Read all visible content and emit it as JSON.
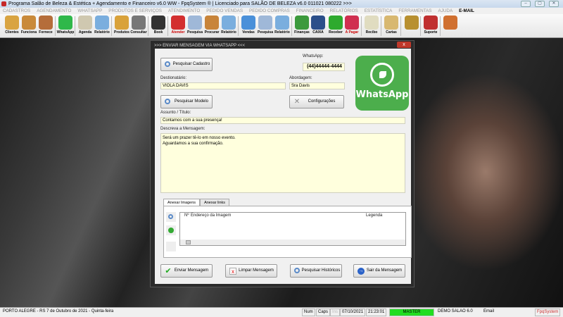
{
  "window": {
    "title": "Programa Salão de Beleza & Estética + Agendamento e Financeiro v6.0 WW - FpqSystem ® | Licenciado para  SALÃO DE BELEZA v6.0 011021 080222 >>>",
    "minimize": "–",
    "maximize": "▢",
    "close": "✕"
  },
  "menu": [
    "CADASTROS",
    "AGENDAMENTO",
    "WHATSAPP",
    "PRODUTOS E SERVIÇOS",
    "ATENDIMENTO",
    "PEDIDO VENDAS",
    "PEDIDO COMPRAS",
    "FINANCEIRO",
    "RELATÓRIOS",
    "ESTATÍSTICA",
    "FERRAMENTAS",
    "AJUDA",
    "E-MAIL"
  ],
  "toolbar": [
    {
      "label": "Clientes",
      "color": "#d9a441"
    },
    {
      "label": "Funciona",
      "color": "#c98a3a"
    },
    {
      "label": "Fornece",
      "color": "#b56d3a"
    },
    {
      "label": "WhatsApp",
      "color": "#2fb84a"
    },
    {
      "label": "Agenda",
      "color": "#cfc8b0"
    },
    {
      "label": "Relatório",
      "color": "#7aaede"
    },
    {
      "label": "Produtos",
      "color": "#d9a23a"
    },
    {
      "label": "Consultar",
      "color": "#777777"
    },
    {
      "label": "Book",
      "color": "#333333"
    },
    {
      "label": "Atender",
      "color": "#d32f2f"
    },
    {
      "label": "Pesquisa",
      "color": "#9fb8d8"
    },
    {
      "label": "Procurar",
      "color": "#c8843a"
    },
    {
      "label": "Relatório",
      "color": "#7aaede"
    },
    {
      "label": "Vendas",
      "color": "#4a90d9"
    },
    {
      "label": "Pesquisa",
      "color": "#9fb8d8"
    },
    {
      "label": "Relatório",
      "color": "#7aaede"
    },
    {
      "label": "Finanças",
      "color": "#3c9a3c"
    },
    {
      "label": "CAIXA",
      "color": "#2b4f8a"
    },
    {
      "label": "Receber",
      "color": "#2eaa2e"
    },
    {
      "label": "A Pagar",
      "color": "#d03050"
    },
    {
      "label": "Recibo",
      "color": "#e0dcc0"
    },
    {
      "label": "Cartas",
      "color": "#d8b870"
    },
    {
      "label": "",
      "color": "#b89030"
    },
    {
      "label": "Suporte",
      "color": "#c03030"
    },
    {
      "label": "",
      "color": "#d07030"
    }
  ],
  "dialog": {
    "title": ">>> ENVIAR MENSAGEM VIA WHATSAPP <<<",
    "close": "x",
    "search_contact": "Pesquisar Cadastro",
    "whatsapp_label": "WhatsApp:",
    "whatsapp_number": "(44)44444-4444",
    "recipient_label": "Destionatário:",
    "recipient": "VIOLA DAVIS",
    "approach_label": "Abordagem:",
    "approach": "Sra Davis",
    "search_template": "Pesquisar Modelo",
    "settings": "Configurações",
    "logo_text": "WhatsApp",
    "subject_label": "Assunto / Título:",
    "subject": "Contamos com a sua presença!",
    "message_label": "Descreva a Mensagem:",
    "message": "Será um prazer tê-lo em nosso evento.\nAguardamos a sua confirmação.",
    "tabs": [
      "Anexar Imagens",
      "Anexar links"
    ],
    "grid_cols": [
      "Nº",
      "Endereço da Imagem",
      "Legenda"
    ],
    "buttons": {
      "send": "Enviar Mensagem",
      "clear": "Limpar Mensagem",
      "history": "Pesquisar Históricos",
      "exit": "Sair da Mensagem"
    }
  },
  "status": {
    "location": "PORTO ALEGRE - RS  7 de Outubro de 2021 - Quinta-feira",
    "num": "Num",
    "caps": "Caps",
    "ins": "Ins",
    "date": "07/10/2021",
    "time": "21:23:01",
    "user": "MASTER",
    "company": "DEMO SALAO 6.0",
    "email": "Email",
    "brand": "FpqSystem"
  }
}
